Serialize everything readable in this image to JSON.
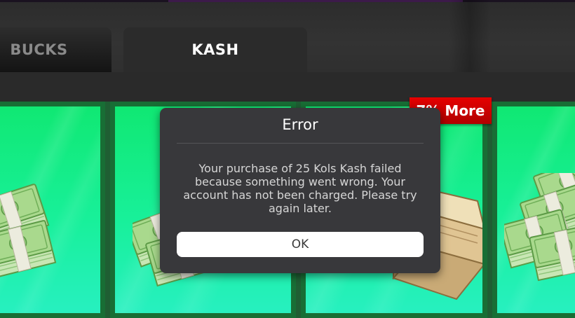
{
  "tabs": {
    "bucks_label": "BUCKS",
    "kash_label": "KASH",
    "active": "KASH"
  },
  "offer_badge": {
    "text": "7% More",
    "color": "#d40000"
  },
  "error_dialog": {
    "title": "Error",
    "message": "Your purchase of 25 Kols Kash failed because something went wrong. Your account has not been charged. Please try again later.",
    "ok_label": "OK"
  },
  "cards": [
    {
      "icon": "cash-stack-icon"
    },
    {
      "icon": "cash-stack-icon"
    },
    {
      "icon": "cash-box-icon"
    },
    {
      "icon": "cash-pile-icon"
    }
  ],
  "colors": {
    "card_green": "#14ec80",
    "card_border": "#186e35",
    "dialog_bg": "#38383b",
    "badge_red": "#d40000"
  }
}
